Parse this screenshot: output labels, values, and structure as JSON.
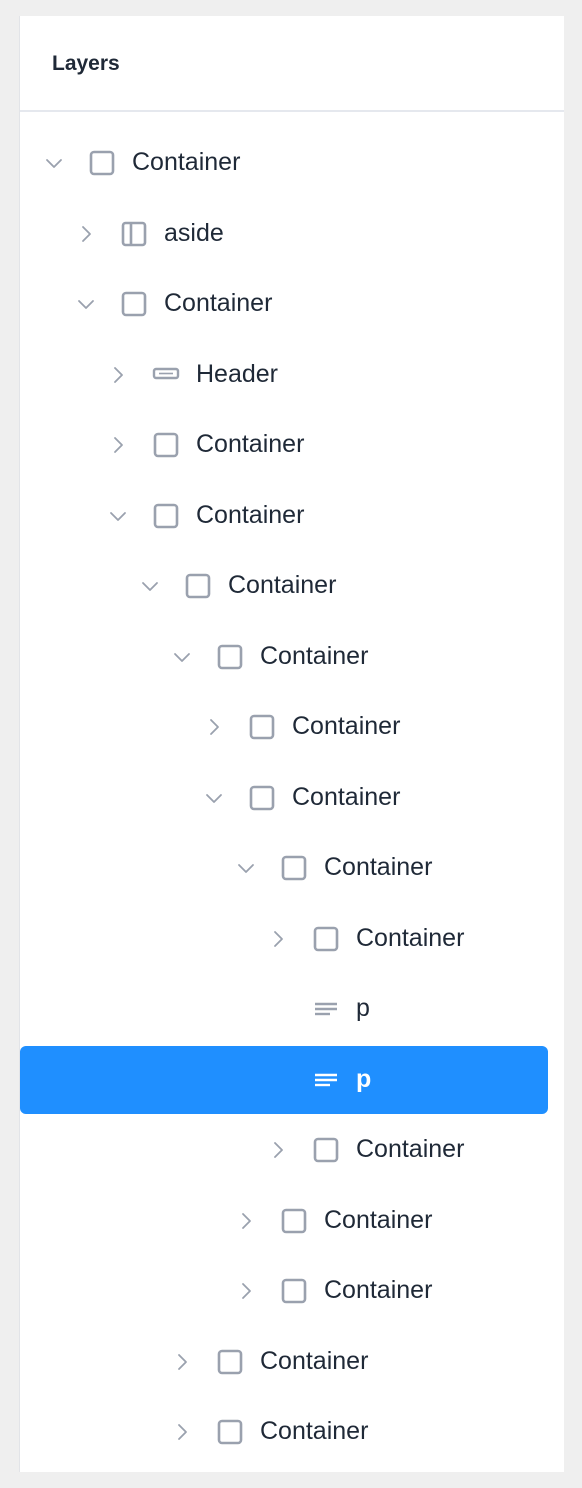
{
  "panel": {
    "title": "Layers"
  },
  "tree": [
    {
      "label": "Container",
      "icon": "container-icon",
      "caret": "expanded",
      "depth": 0
    },
    {
      "label": "aside",
      "icon": "aside-icon",
      "caret": "collapsed",
      "depth": 1
    },
    {
      "label": "Container",
      "icon": "container-icon",
      "caret": "expanded",
      "depth": 1
    },
    {
      "label": "Header",
      "icon": "header-icon",
      "caret": "collapsed",
      "depth": 2
    },
    {
      "label": "Container",
      "icon": "container-icon",
      "caret": "collapsed",
      "depth": 2
    },
    {
      "label": "Container",
      "icon": "container-icon",
      "caret": "expanded",
      "depth": 2
    },
    {
      "label": "Container",
      "icon": "container-icon",
      "caret": "expanded",
      "depth": 3
    },
    {
      "label": "Container",
      "icon": "container-icon",
      "caret": "expanded",
      "depth": 4
    },
    {
      "label": "Container",
      "icon": "container-icon",
      "caret": "collapsed",
      "depth": 5
    },
    {
      "label": "Container",
      "icon": "container-icon",
      "caret": "expanded",
      "depth": 5
    },
    {
      "label": "Container",
      "icon": "container-icon",
      "caret": "expanded",
      "depth": 6
    },
    {
      "label": "Container",
      "icon": "container-icon",
      "caret": "collapsed",
      "depth": 7
    },
    {
      "label": "p",
      "icon": "text-icon",
      "caret": "none",
      "depth": 7
    },
    {
      "label": "p",
      "icon": "text-icon",
      "caret": "none",
      "depth": 7,
      "selected": true
    },
    {
      "label": "Container",
      "icon": "container-icon",
      "caret": "collapsed",
      "depth": 7
    },
    {
      "label": "Container",
      "icon": "container-icon",
      "caret": "collapsed",
      "depth": 6
    },
    {
      "label": "Container",
      "icon": "container-icon",
      "caret": "collapsed",
      "depth": 6
    },
    {
      "label": "Container",
      "icon": "container-icon",
      "caret": "collapsed",
      "depth": 4
    },
    {
      "label": "Container",
      "icon": "container-icon",
      "caret": "collapsed",
      "depth": 4
    }
  ],
  "colors": {
    "selected_bg": "#1f8fff",
    "icon_stroke": "#9aa1ae",
    "text": "#1f2937",
    "caret": "#9aa1ae"
  }
}
